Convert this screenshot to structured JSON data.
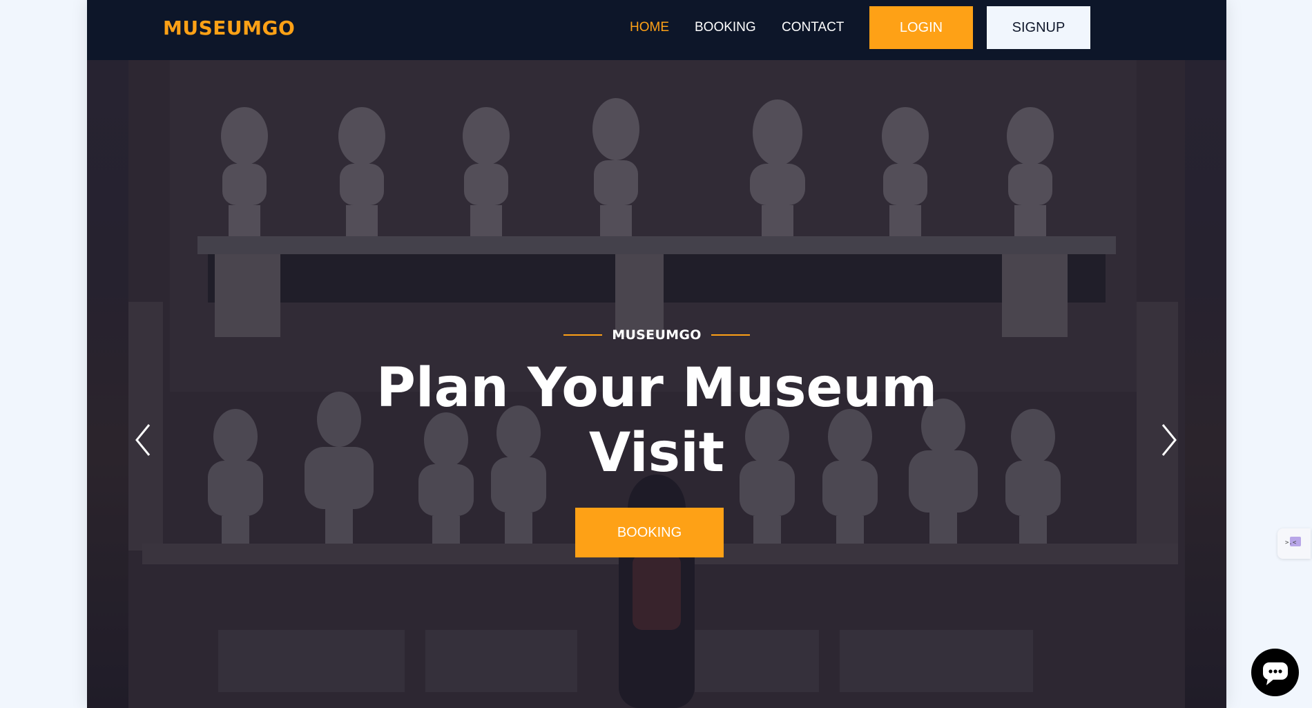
{
  "nav": {
    "brand": "MUSEUMGO",
    "links": [
      {
        "label": "HOME",
        "active": true
      },
      {
        "label": "BOOKING",
        "active": false
      },
      {
        "label": "CONTACT",
        "active": false
      }
    ],
    "login_label": "LOGIN",
    "signup_label": "SIGNUP"
  },
  "hero": {
    "subtitle": "MUSEUMGO",
    "title_line1": "Plan Your Museum",
    "title_line2": "Visit",
    "cta_label": "BOOKING",
    "prev_icon": "chevron-left-icon",
    "next_icon": "chevron-right-icon"
  },
  "widgets": {
    "side_tab_icon": "translate-icon",
    "chat_icon": "chat-bubble-icon"
  },
  "colors": {
    "accent": "#fea116",
    "navbar": "#0d1629",
    "page_background": "#f1f6fd",
    "signup_button": "#f1f6fd"
  }
}
